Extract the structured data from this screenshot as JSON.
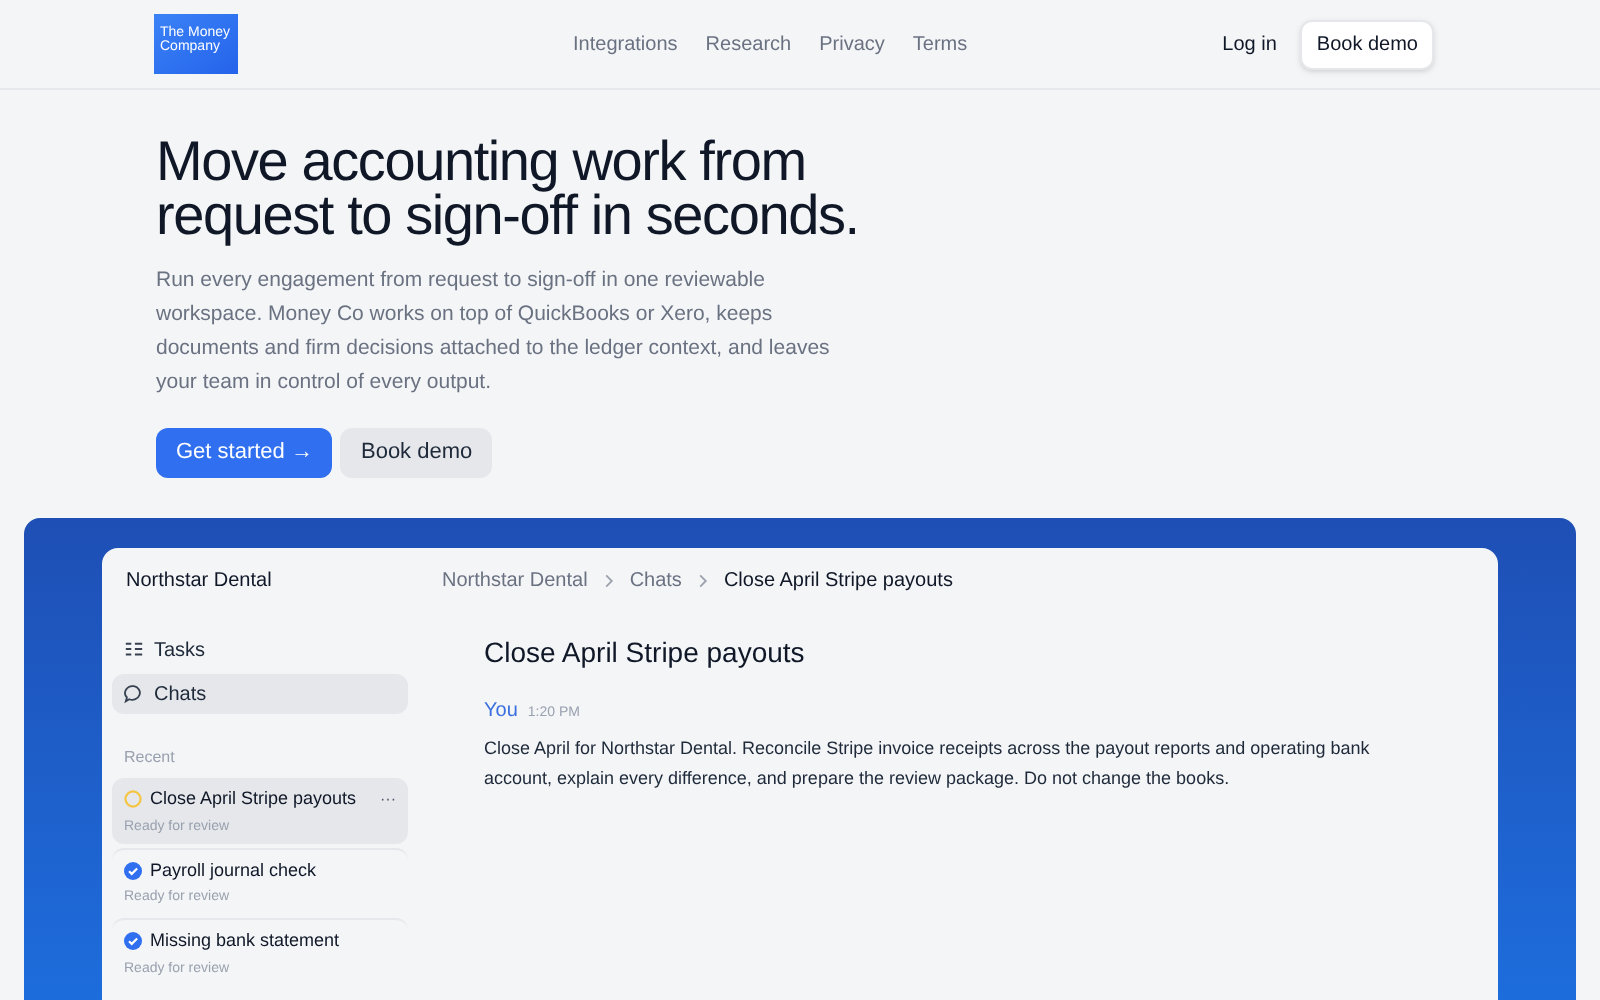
{
  "header": {
    "logo": "The Money Company",
    "nav": [
      "Integrations",
      "Research",
      "Privacy",
      "Terms"
    ],
    "login": "Log in",
    "cta": "Book demo"
  },
  "hero": {
    "title": "Move accounting work from request to sign-off in seconds.",
    "text": "Run every engagement from request to sign-off in one reviewable workspace. Money Co works on top of QuickBooks or Xero, keeps documents and firm decisions attached to the ledger context, and leaves your team in control of every output.",
    "primary": "Get started →",
    "secondary": "Book demo"
  },
  "app": {
    "workspace": "Northstar Dental",
    "breadcrumb": [
      "Northstar Dental",
      "Chats",
      "Close April Stripe payouts"
    ],
    "nav": [
      {
        "kind": "tasks",
        "label": "Tasks",
        "selected": false
      },
      {
        "kind": "chats",
        "label": "Chats",
        "selected": true
      }
    ],
    "recent_label": "Recent",
    "recent": [
      {
        "title": "Close April Stripe payouts",
        "status": "Ready for review",
        "kind": "pending",
        "selected": true,
        "menu": "···"
      },
      {
        "title": "Payroll journal check",
        "status": "Ready for review",
        "kind": "done",
        "selected": false
      },
      {
        "title": "Missing bank statement",
        "status": "Ready for review",
        "kind": "done",
        "selected": false
      }
    ],
    "chat": {
      "title": "Close April Stripe payouts",
      "author": "You",
      "time": "1:20 PM",
      "message": "Close April for Northstar Dental. Reconcile Stripe invoice receipts across the payout reports and operating bank account, explain every difference, and prepare the review package. Do not change the books."
    }
  }
}
